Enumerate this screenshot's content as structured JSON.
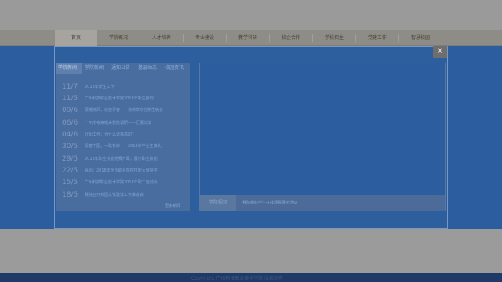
{
  "nav": {
    "items": [
      "首页",
      "学院概况",
      "人才培养",
      "专业建设",
      "教学科研",
      "校企合作",
      "学校招生",
      "党建工作",
      "智慧校园"
    ]
  },
  "modal": {
    "close_label": "X"
  },
  "news": {
    "tabs": [
      "学院新闻",
      "学院新闻",
      "通知公告",
      "基层动态",
      "校园资讯"
    ],
    "items": [
      {
        "date": "11/7",
        "title": "2018年新生工作"
      },
      {
        "date": "11/5",
        "title": "广州科技职业技术学院2018年新生报到"
      },
      {
        "date": "09/6",
        "title": "展潮流风，绽放青春——我校举办迎新生晚会"
      },
      {
        "date": "06/6",
        "title": "广州市考察组来我院调研——汇报交流"
      },
      {
        "date": "04/6",
        "title": "分配工作：为什么选择高职？"
      },
      {
        "date": "30/5",
        "title": "青春中国，一路有你——2018年毕业生典礼"
      },
      {
        "date": "29/5",
        "title": "2018年职业技能竞赛开幕，展示职业技能"
      },
      {
        "date": "22/5",
        "title": "喜讯：2018年全国职业院校技能大赛获奖"
      },
      {
        "date": "15/5",
        "title": "广州科技职业技术学院2018年职工运动会"
      },
      {
        "date": "18/5",
        "title": "我院召开校园文化建设工作推进会"
      }
    ],
    "more_label": "更多新闻"
  },
  "video": {
    "tag": "学院视频",
    "caption": "我院组织学生在线观看展示活动"
  },
  "footer": {
    "text": "Copyright 广州科技职业技术学院  版权所有"
  },
  "colors": {
    "modal_bg": "#2d5e9e",
    "overlay_gray": "#9a9a9a",
    "accent_blue": "#2c5d9e"
  }
}
